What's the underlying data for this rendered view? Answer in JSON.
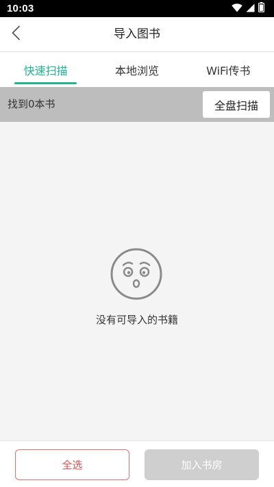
{
  "status_bar": {
    "time": "10:03",
    "icons": [
      "wifi-icon",
      "signal-icon",
      "battery-icon"
    ]
  },
  "app_bar": {
    "back_icon": "chevron-left-icon",
    "title": "导入图书"
  },
  "tabs": [
    {
      "label": "快速扫描",
      "active": true
    },
    {
      "label": "本地浏览",
      "active": false
    },
    {
      "label": "WiFi传书",
      "active": false
    }
  ],
  "scan_bar": {
    "found_text": "找到0本书",
    "full_scan_label": "全盘扫描"
  },
  "empty_state": {
    "icon": "worried-face-icon",
    "message": "没有可导入的书籍"
  },
  "bottom_bar": {
    "select_all_label": "全选",
    "add_to_shelf_label": "加入书房"
  },
  "colors": {
    "accent": "#1fb58f",
    "danger": "#e05050",
    "disabled": "#cfcfcf",
    "scan_bar_bg": "#bdbdbd",
    "page_bg": "#f4f4f4"
  }
}
